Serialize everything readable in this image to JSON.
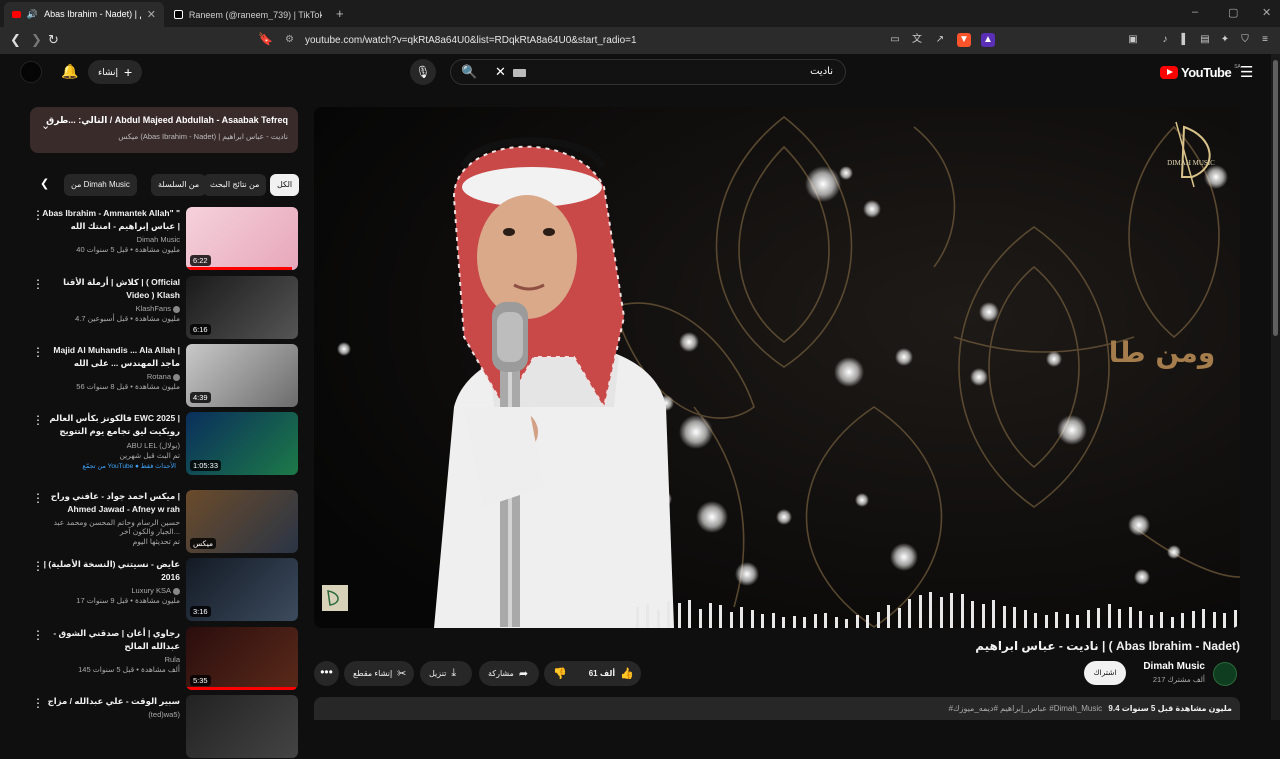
{
  "browser": {
    "tabs": [
      {
        "title": "Abas Ibrahim - Nadet) | عيم",
        "active": true
      },
      {
        "title": "Raneem (@raneem_739) | TikTok",
        "active": false
      }
    ],
    "new_tab": "+",
    "window_controls": [
      "–",
      "▢",
      "✕"
    ],
    "url": "youtube.com/watch?v=qkRtA8a64U0&list=RDqkRtA8a64U0&start_radio=1"
  },
  "masthead": {
    "create_label": "إنشاء",
    "search_query": "ناديت",
    "logo_text": "YouTube",
    "country_code": "SA"
  },
  "playlist": {
    "title": "التالي: ...طرق / Abdul Majeed Abdullah - Asaabak Tefreq",
    "subtitle": "ميكس (Abas Ibrahim - Nadet) | ناديت - عباس ابراهيم"
  },
  "chips": [
    {
      "label": "الكل",
      "active": true
    },
    {
      "label": "من نتائج البحث",
      "active": false
    },
    {
      "label": "من السلسلة",
      "active": false
    },
    {
      "label": "من Dimah Music",
      "active": false
    }
  ],
  "recommendations": [
    {
      "title": "Abas Ibrahim - Ammantek Allah\" \" عباس إبراهيم - امنتك الله |",
      "channel": "Dimah Music",
      "verified": false,
      "meta": "40 مليون مشاهدة • قبل 5 سنوات",
      "duration": "6:22",
      "progress": 0.95,
      "thumb": "pink"
    },
    {
      "title": "كلاش | أرملة الأقنا | ( Official Video ) Klash",
      "channel": "KlashFans",
      "verified": true,
      "meta": "4.7 مليون مشاهدة • قبل أسبوعين",
      "duration": "6:16",
      "progress": 0,
      "thumb": "dark"
    },
    {
      "title": "Majid Al Muhandis ... Ala Allah | ماجد المهندس ... على الله",
      "channel": "Rotana",
      "verified": true,
      "meta": "56 مليون مشاهدة • قبل 8 سنوات",
      "duration": "4:39",
      "progress": 0,
      "thumb": "grey"
    },
    {
      "title": "فالكونز بكأس العالم EWC 2025 | رويكيت ليق تجامع يوم التتويج لكأس العالم",
      "channel": "ABU LEL (بولال)",
      "verified": false,
      "meta": "تم البث قبل شهرين",
      "extra": "من تجمّع YouTube ● الأحداث فقط",
      "duration": "1:05:33",
      "progress": 0,
      "thumb": "ewc"
    },
    {
      "title": "ميكس احمد جواد - عافني وراح | Ahmed Jawad - Afney w rah",
      "channel": "حسين الرسام وحاتم المحسن ومحمد عبد الجبار والكون آخر...",
      "verified": false,
      "meta": "تم تحديثها اليوم",
      "duration": "ميكس",
      "progress": 0,
      "thumb": "mix"
    },
    {
      "title": "عايض - نسيتني (النسخة الأصلية) | 2016",
      "channel": "Luxury KSA",
      "verified": true,
      "meta": "17 مليون مشاهدة • قبل 9 سنوات",
      "duration": "3:16",
      "progress": 0,
      "thumb": "blue"
    },
    {
      "title": "رجاوي | أغان | صدقني الشوق - عبدالله المالح",
      "channel": "Rula",
      "verified": false,
      "meta": "145 ألف مشاهدة • قبل 5 سنوات",
      "duration": "5:35",
      "progress": 0.98,
      "thumb": "red"
    },
    {
      "title": "سبير الوقت - علي عبدالله / مزاج",
      "channel": "(ted)wa5)",
      "verified": false,
      "meta": "",
      "duration": "",
      "progress": 0,
      "thumb": "dark2"
    }
  ],
  "player": {
    "overlay_text": "ومن طا",
    "brand": "DIMAH MUSIC",
    "corner_logo": "Dimah Music"
  },
  "video": {
    "title": "ناديت - عباس ابراهيم | ( Abas Ibrahim - Nadet)",
    "channel": "Dimah Music",
    "subscribers": "217 ألف مشترك",
    "subscribe": "اشتراك",
    "likes": "61 ألف",
    "share": "مشاركة",
    "download": "تنزيل",
    "clip": "إنشاء مقطع",
    "views_age": "9.4 مليون مشاهدة  قبل 5 سنوات",
    "hashtags": "#عباس_إبراهيم #ديمه_ميوزك #Dimah_Music"
  },
  "colors": {
    "accent": "#ff0000",
    "background": "#0f0f0f",
    "surface": "#272727",
    "playlist_card": "#3a2b2b"
  },
  "icons": {
    "back": "arrow-left-icon",
    "forward": "arrow-right-icon",
    "reload": "reload-icon",
    "bookmark": "bookmark-icon",
    "mic": "mic-icon",
    "search": "search-icon",
    "bell": "bell-icon",
    "like": "thumb-up-icon",
    "dislike": "thumb-down-icon"
  }
}
